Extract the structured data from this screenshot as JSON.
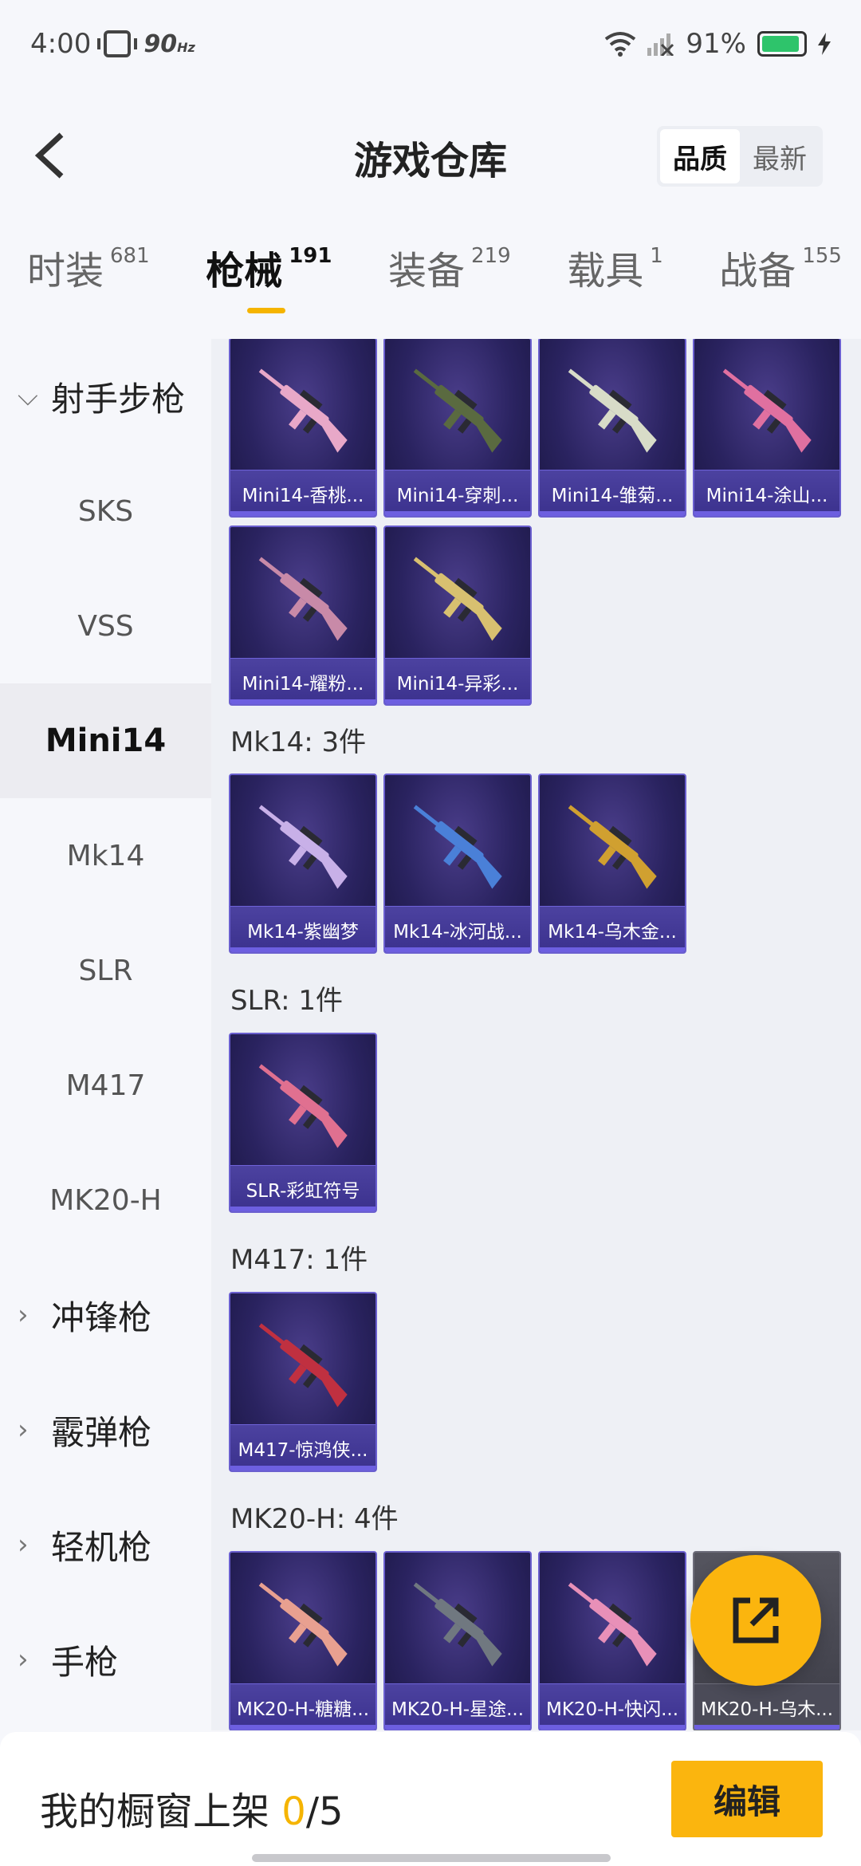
{
  "status_bar": {
    "time": "4:00",
    "refresh": "90",
    "refresh_unit": "Hz",
    "battery": "91%"
  },
  "header": {
    "title": "游戏仓库",
    "sort_options": [
      "品质",
      "最新"
    ],
    "sort_active": "品质"
  },
  "tabs": [
    {
      "label": "时装",
      "count": "681"
    },
    {
      "label": "枪械",
      "count": "191"
    },
    {
      "label": "装备",
      "count": "219"
    },
    {
      "label": "载具",
      "count": "1"
    },
    {
      "label": "战备",
      "count": "155"
    }
  ],
  "sidebar": {
    "items": [
      {
        "label": "射手步枪",
        "group": true,
        "expanded": true
      },
      {
        "label": "SKS"
      },
      {
        "label": "VSS"
      },
      {
        "label": "Mini14",
        "active": true
      },
      {
        "label": "Mk14"
      },
      {
        "label": "SLR"
      },
      {
        "label": "M417"
      },
      {
        "label": "MK20-H"
      },
      {
        "label": "冲锋枪",
        "group": true
      },
      {
        "label": "霰弹枪",
        "group": true
      },
      {
        "label": "轻机枪",
        "group": true
      },
      {
        "label": "手枪",
        "group": true
      }
    ]
  },
  "sections": [
    {
      "title": "",
      "items": [
        {
          "name": "Mini14-香桃...",
          "color": "#e8a8c8"
        },
        {
          "name": "Mini14-穿刺...",
          "color": "#5a6a40"
        },
        {
          "name": "Mini14-雏菊...",
          "color": "#d8dcc8"
        },
        {
          "name": "Mini14-涂山...",
          "color": "#e070a0"
        },
        {
          "name": "Mini14-耀粉...",
          "color": "#c88aa8"
        },
        {
          "name": "Mini14-异彩...",
          "color": "#d8c070"
        }
      ]
    },
    {
      "title": "Mk14: 3件",
      "items": [
        {
          "name": "Mk14-紫幽梦",
          "color": "#c8b0e8"
        },
        {
          "name": "Mk14-冰河战...",
          "color": "#4a80d8"
        },
        {
          "name": "Mk14-乌木金...",
          "color": "#d0a030"
        }
      ]
    },
    {
      "title": "SLR: 1件",
      "items": [
        {
          "name": "SLR-彩虹符号",
          "color": "#e07090"
        }
      ]
    },
    {
      "title": "M417: 1件",
      "items": [
        {
          "name": "M417-惊鸿侠...",
          "color": "#c03040"
        }
      ]
    },
    {
      "title": "MK20-H: 4件",
      "items": [
        {
          "name": "MK20-H-糖糖...",
          "color": "#e8a090"
        },
        {
          "name": "MK20-H-星途...",
          "color": "#707880"
        },
        {
          "name": "MK20-H-快闪...",
          "color": "#e890b8"
        },
        {
          "name": "MK20-H-乌木...",
          "color": "#c0a040",
          "grey": true
        }
      ]
    }
  ],
  "bottom": {
    "shop_label": "我的橱窗上架",
    "shop_count": "0",
    "shop_total": "/5",
    "edit_label": "编辑"
  }
}
